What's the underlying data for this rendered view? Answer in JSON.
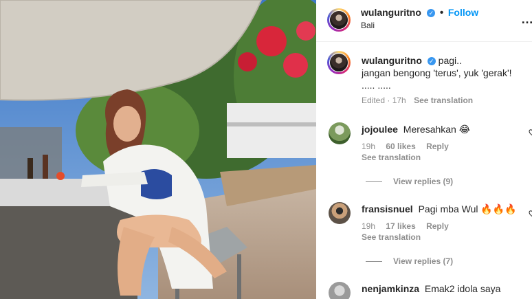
{
  "post": {
    "username": "wulanguritno",
    "follow_label": "Follow",
    "location": "Bali",
    "more_icon": "…"
  },
  "caption": {
    "username": "wulanguritno",
    "line1": "pagi..",
    "line2": "jangan bengong 'terus', yuk 'gerak'!",
    "line3": "..... .....",
    "edited": "Edited",
    "time": "17h",
    "see_translation": "See translation"
  },
  "comments": [
    {
      "username": "jojoulee",
      "text": "Meresahkan 😂",
      "time": "19h",
      "likes": "60 likes",
      "reply": "Reply",
      "see_translation": "See translation",
      "view_replies": "View replies (9)"
    },
    {
      "username": "fransisnuel",
      "text": "Pagi mba Wul 🔥🔥🔥",
      "time": "19h",
      "likes": "17 likes",
      "reply": "Reply",
      "see_translation": "See translation",
      "view_replies": "View replies (7)"
    },
    {
      "username": "nenjamkinza",
      "text": "Emak2 idola saya"
    }
  ],
  "colors": {
    "accent": "#0095f6",
    "verified": "#3897f0",
    "muted": "#8e8e8e"
  }
}
